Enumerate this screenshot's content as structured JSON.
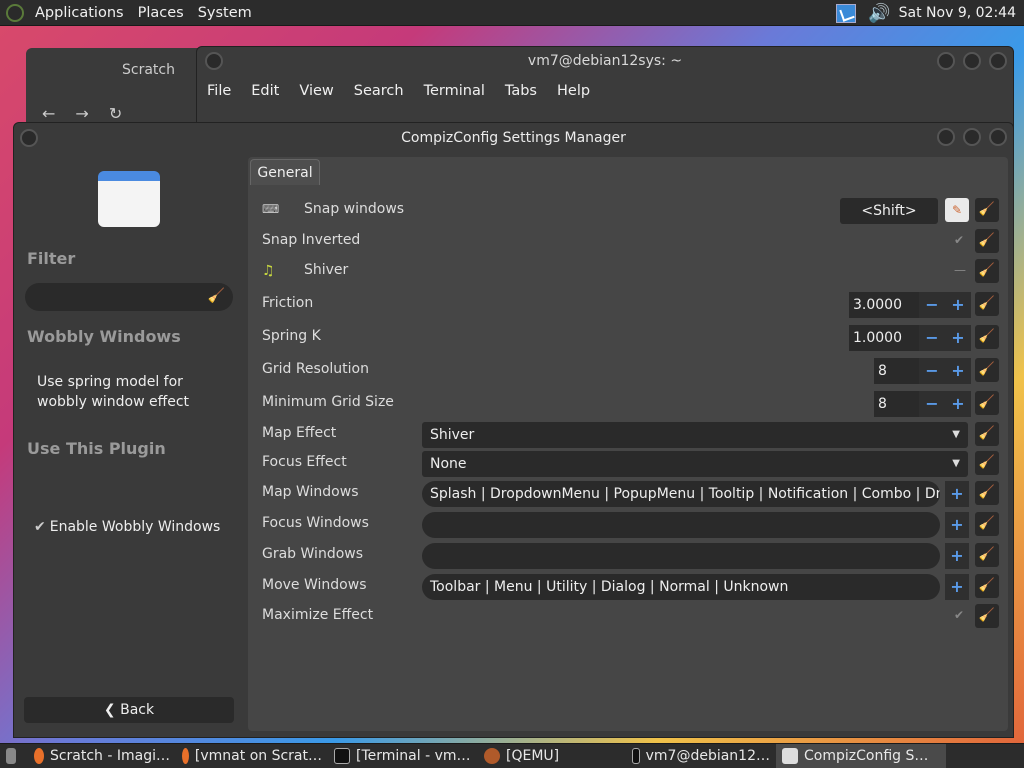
{
  "topbar": {
    "menus": [
      "Applications",
      "Places",
      "System"
    ],
    "clock": "Sat Nov 9, 02:44"
  },
  "bg_browser": {
    "tab": "Scratch"
  },
  "terminal": {
    "title": "vm7@debian12sys: ~",
    "menus": [
      "File",
      "Edit",
      "View",
      "Search",
      "Terminal",
      "Tabs",
      "Help"
    ]
  },
  "ccsm": {
    "title": "CompizConfig Settings Manager",
    "filter_heading": "Filter",
    "plugin_heading": "Wobbly Windows",
    "description": "Use spring model for wobbly window effect",
    "use_heading": "Use This Plugin",
    "enable_label": "Enable Wobbly Windows",
    "back_label": "Back",
    "tab": "General",
    "rows": {
      "snap_windows": {
        "label": "Snap windows",
        "key": "<Shift>"
      },
      "snap_inverted": {
        "label": "Snap Inverted"
      },
      "shiver": {
        "label": "Shiver"
      },
      "friction": {
        "label": "Friction",
        "value": "3.0000"
      },
      "spring_k": {
        "label": "Spring K",
        "value": "1.0000"
      },
      "grid_resolution": {
        "label": "Grid Resolution",
        "value": "8"
      },
      "min_grid_size": {
        "label": "Minimum Grid Size",
        "value": "8"
      },
      "map_effect": {
        "label": "Map Effect",
        "value": "Shiver"
      },
      "focus_effect": {
        "label": "Focus Effect",
        "value": "None"
      },
      "map_windows": {
        "label": "Map Windows",
        "value": "Splash | DropdownMenu | PopupMenu | Tooltip | Notification | Combo | Dnd | Unknown"
      },
      "focus_windows": {
        "label": "Focus Windows",
        "value": ""
      },
      "grab_windows": {
        "label": "Grab Windows",
        "value": ""
      },
      "move_windows": {
        "label": "Move Windows",
        "value": "Toolbar | Menu | Utility | Dialog | Normal | Unknown"
      },
      "maximize_effect": {
        "label": "Maximize Effect"
      }
    }
  },
  "taskbar": {
    "items": [
      "Scratch - Imagi…",
      "[vmnat on Scrat…",
      "[Terminal - vm…",
      "[QEMU]",
      "vm7@debian12…",
      "CompizConfig S…"
    ]
  },
  "colors": {
    "accent": "#5a9ae8",
    "reset": "#e8c840",
    "panel": "#2c2c2c"
  }
}
